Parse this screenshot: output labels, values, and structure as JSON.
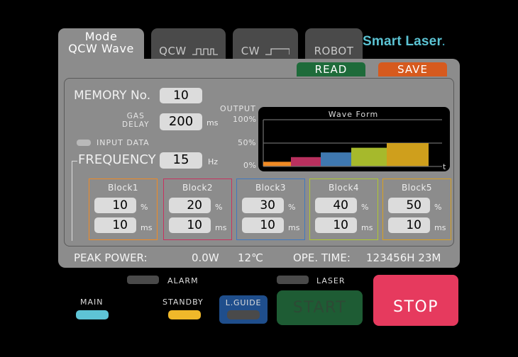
{
  "tabs": [
    {
      "line1": "Mode",
      "line2": "QCW Wave",
      "active": true
    },
    {
      "label": "QCW",
      "glyph": "pulse-train-icon",
      "active": false
    },
    {
      "label": "CW",
      "glyph": "step-icon",
      "active": false
    },
    {
      "label": "ROBOT",
      "active": false
    }
  ],
  "brand": "Smart Laser",
  "brand_dot": ".",
  "toolbar": {
    "read_label": "READ",
    "save_label": "SAVE"
  },
  "memory": {
    "label": "MEMORY No.",
    "value": "10"
  },
  "gas_delay": {
    "label_line1": "GAS",
    "label_line2": "DELAY",
    "value": "200",
    "unit": "ms"
  },
  "input_data": {
    "label": "INPUT DATA"
  },
  "frequency": {
    "label": "FREQUENCY",
    "value": "15",
    "unit": "Hz"
  },
  "output_axis": {
    "title": "OUTPUT",
    "ticks": [
      "100%",
      "50%",
      "0%"
    ]
  },
  "chart_data": {
    "type": "bar",
    "title": "Wave Form",
    "xlabel": "t",
    "ylabel": "OUTPUT",
    "ylim": [
      0,
      100
    ],
    "yticks": [
      "0%",
      "50%",
      "100%"
    ],
    "grid": true,
    "categories": [
      "Block1",
      "Block2",
      "Block3",
      "Block4",
      "Block5"
    ],
    "values": [
      10,
      20,
      30,
      40,
      50
    ],
    "durations_ms": [
      10,
      10,
      10,
      10,
      10
    ],
    "colors": [
      "#f08a24",
      "#b8305e",
      "#3f78b0",
      "#a6b92c",
      "#cf9f1c"
    ]
  },
  "blocks": [
    {
      "title": "Block1",
      "percent": "10",
      "time": "10",
      "percent_unit": "%",
      "time_unit": "ms",
      "color": "#f08a24"
    },
    {
      "title": "Block2",
      "percent": "20",
      "time": "10",
      "percent_unit": "%",
      "time_unit": "ms",
      "color": "#c8325f"
    },
    {
      "title": "Block3",
      "percent": "30",
      "time": "10",
      "percent_unit": "%",
      "time_unit": "ms",
      "color": "#3f78c0"
    },
    {
      "title": "Block4",
      "percent": "40",
      "time": "10",
      "percent_unit": "%",
      "time_unit": "ms",
      "color": "#b0c830"
    },
    {
      "title": "Block5",
      "percent": "50",
      "time": "10",
      "percent_unit": "%",
      "time_unit": "ms",
      "color": "#d9a020"
    }
  ],
  "status": {
    "peak_power_label": "PEAK POWER:",
    "peak_power_value": "0.0W",
    "temperature": "12℃",
    "ope_time_label": "OPE. TIME:",
    "ope_time_value": "123456H 23M"
  },
  "indicators": {
    "alarm": {
      "label": "ALARM",
      "color": "#4a4a4a"
    },
    "laser": {
      "label": "LASER",
      "color": "#4a4a4a"
    },
    "main": {
      "label": "MAIN",
      "color": "#5ec4d6"
    },
    "standby": {
      "label": "STANDBY",
      "color": "#f0b82a"
    }
  },
  "buttons": {
    "lguide": {
      "label": "L.GUIDE",
      "color": "#1f4e8c"
    },
    "start": {
      "label": "START",
      "color": "#1e5c34"
    },
    "stop": {
      "label": "STOP",
      "color": "#e63a5e"
    }
  }
}
